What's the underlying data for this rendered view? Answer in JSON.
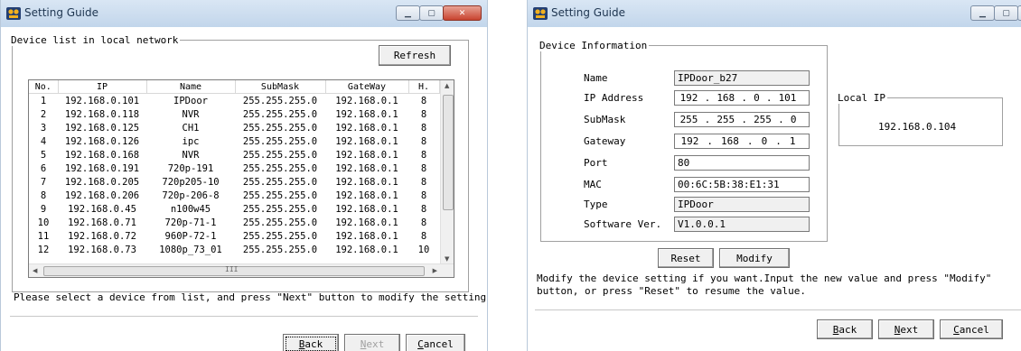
{
  "left_window": {
    "title": "Setting Guide",
    "group_label": "Device list in local network",
    "refresh_label": "Refresh",
    "columns": [
      "No.",
      "IP",
      "Name",
      "SubMask",
      "GateWay",
      "H."
    ],
    "rows": [
      [
        "1",
        "192.168.0.101",
        "IPDoor",
        "255.255.255.0",
        "192.168.0.1",
        "8"
      ],
      [
        "2",
        "192.168.0.118",
        "NVR",
        "255.255.255.0",
        "192.168.0.1",
        "8"
      ],
      [
        "3",
        "192.168.0.125",
        "CH1",
        "255.255.255.0",
        "192.168.0.1",
        "8"
      ],
      [
        "4",
        "192.168.0.126",
        "ipc",
        "255.255.255.0",
        "192.168.0.1",
        "8"
      ],
      [
        "5",
        "192.168.0.168",
        "NVR",
        "255.255.255.0",
        "192.168.0.1",
        "8"
      ],
      [
        "6",
        "192.168.0.191",
        "720p-191",
        "255.255.255.0",
        "192.168.0.1",
        "8"
      ],
      [
        "7",
        "192.168.0.205",
        "720p205-10",
        "255.255.255.0",
        "192.168.0.1",
        "8"
      ],
      [
        "8",
        "192.168.0.206",
        "720p-206-8",
        "255.255.255.0",
        "192.168.0.1",
        "8"
      ],
      [
        "9",
        "192.168.0.45",
        "n100w45",
        "255.255.255.0",
        "192.168.0.1",
        "8"
      ],
      [
        "10",
        "192.168.0.71",
        "720p-71-1",
        "255.255.255.0",
        "192.168.0.1",
        "8"
      ],
      [
        "11",
        "192.168.0.72",
        "960P-72-1",
        "255.255.255.0",
        "192.168.0.1",
        "8"
      ],
      [
        "12",
        "192.168.0.73",
        "1080p_73_01",
        "255.255.255.0",
        "192.168.0.1",
        "10"
      ]
    ],
    "hscroll_grip": "III",
    "instruction": "Please select a device from list, and press \"Next\" button to modify the setting.",
    "back_label": "Back",
    "next_label": "Next",
    "cancel_label": "Cancel",
    "back_underline": "B",
    "back_rest": "ack",
    "next_underline": "N",
    "next_rest": "ext",
    "cancel_underline": "C",
    "cancel_rest": "ancel"
  },
  "right_window": {
    "title": "Setting Guide",
    "group_label": "Device Information",
    "fields": {
      "name": {
        "label": "Name",
        "value": "IPDoor_b27"
      },
      "ip": {
        "label": "IP Address",
        "octets": [
          "192",
          "168",
          "0",
          "101"
        ]
      },
      "submask": {
        "label": "SubMask",
        "octets": [
          "255",
          "255",
          "255",
          "0"
        ]
      },
      "gateway": {
        "label": "Gateway",
        "octets": [
          "192",
          "168",
          "0",
          "1"
        ]
      },
      "port": {
        "label": "Port",
        "value": "80"
      },
      "mac": {
        "label": "MAC",
        "value": "00:6C:5B:38:E1:31"
      },
      "type": {
        "label": "Type",
        "value": "IPDoor"
      },
      "software": {
        "label": "Software Ver.",
        "value": "V1.0.0.1"
      }
    },
    "reset_label": "Reset",
    "modify_label": "Modify",
    "local_ip_label": "Local IP",
    "local_ip_value": "192.168.0.104",
    "instruction_line1": "Modify the device setting if you want.Input the new value and press \"Modify\"",
    "instruction_line2": "button, or press \"Reset\" to resume the value.",
    "back_underline": "B",
    "back_rest": "ack",
    "next_underline": "N",
    "next_rest": "ext",
    "cancel_underline": "C",
    "cancel_rest": "ancel"
  },
  "icons": {
    "app": "setting-guide-app-icon",
    "minimize": "minimize-icon",
    "maximize": "maximize-icon",
    "close": "close-icon"
  }
}
